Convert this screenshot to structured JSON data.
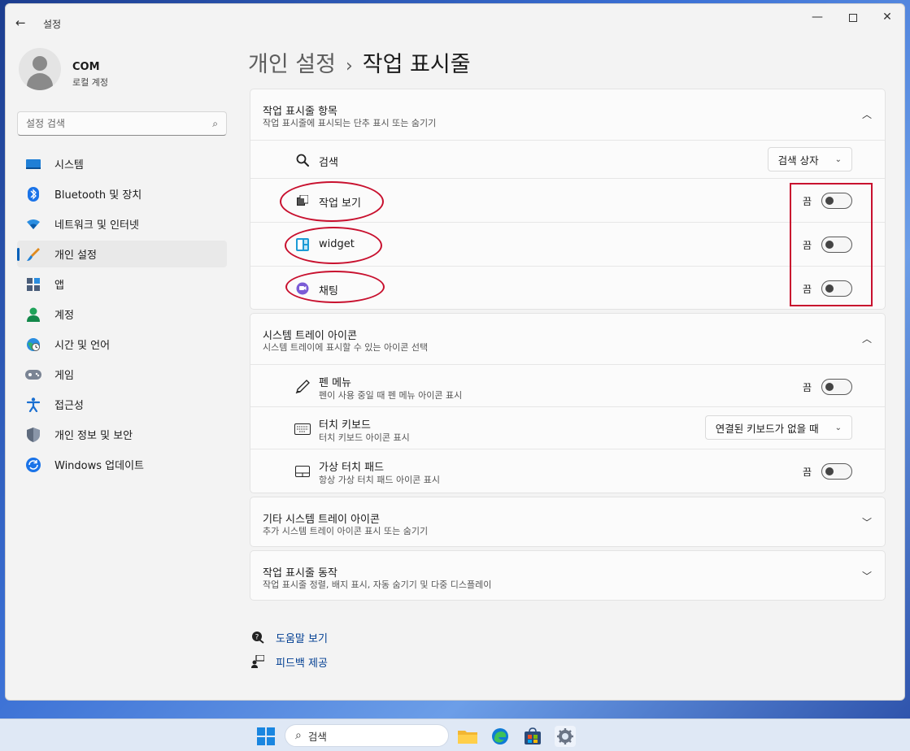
{
  "window": {
    "app_title": "설정",
    "back_glyph": "←",
    "controls": {
      "minimize": "—",
      "close": "✕"
    }
  },
  "profile": {
    "name": "COM",
    "account_type": "로컬 계정"
  },
  "sidebar": {
    "search_placeholder": "설정 검색",
    "items": [
      {
        "label": "시스템",
        "icon": "monitor-icon"
      },
      {
        "label": "Bluetooth 및 장치",
        "icon": "bluetooth-icon"
      },
      {
        "label": "네트워크 및 인터넷",
        "icon": "wifi-icon"
      },
      {
        "label": "개인 설정",
        "icon": "brush-icon",
        "active": true
      },
      {
        "label": "앱",
        "icon": "apps-icon"
      },
      {
        "label": "계정",
        "icon": "person-icon"
      },
      {
        "label": "시간 및 언어",
        "icon": "globe-clock-icon"
      },
      {
        "label": "게임",
        "icon": "gamepad-icon"
      },
      {
        "label": "접근성",
        "icon": "accessibility-icon"
      },
      {
        "label": "개인 정보 및 보안",
        "icon": "shield-icon"
      },
      {
        "label": "Windows 업데이트",
        "icon": "update-icon"
      }
    ]
  },
  "breadcrumb": {
    "parent": "개인 설정",
    "separator": "›",
    "current": "작업 표시줄"
  },
  "taskbar_items": {
    "title": "작업 표시줄 항목",
    "subtitle": "작업 표시줄에 표시되는 단추 표시 또는 숨기기",
    "search_row": {
      "label": "검색",
      "value": "검색 상자"
    },
    "rows": [
      {
        "label": "작업 보기",
        "state": "끔",
        "icon": "task-view-icon"
      },
      {
        "label": "widget",
        "state": "끔",
        "icon": "widgets-icon"
      },
      {
        "label": "채팅",
        "state": "끔",
        "icon": "chat-icon"
      }
    ]
  },
  "system_tray": {
    "title": "시스템 트레이 아이콘",
    "subtitle": "시스템 트레이에 표시할 수 있는 아이콘 선택",
    "pen": {
      "label": "펜 메뉴",
      "sub": "펜이 사용 중일 때 펜 메뉴 아이콘 표시",
      "state": "끔"
    },
    "touch_keyboard": {
      "label": "터치 키보드",
      "sub": "터치 키보드 아이콘 표시",
      "value": "연결된 키보드가 없을 때"
    },
    "touchpad": {
      "label": "가상 터치 패드",
      "sub": "항상 가상 터치 패드 아이콘 표시",
      "state": "끔"
    }
  },
  "other_tray": {
    "title": "기타 시스템 트레이 아이콘",
    "subtitle": "추가 시스템 트레이 아이콘 표시 또는 숨기기"
  },
  "behaviors": {
    "title": "작업 표시줄 동작",
    "subtitle": "작업 표시줄 정렬, 배지 표시, 자동 숨기기 및 다중 디스플레이"
  },
  "links": {
    "help": "도움말 보기",
    "feedback": "피드백 제공"
  },
  "taskbar": {
    "search_text": "검색"
  },
  "colors": {
    "accent": "#005fb8",
    "annotation": "#c8102e",
    "link": "#003e92"
  }
}
